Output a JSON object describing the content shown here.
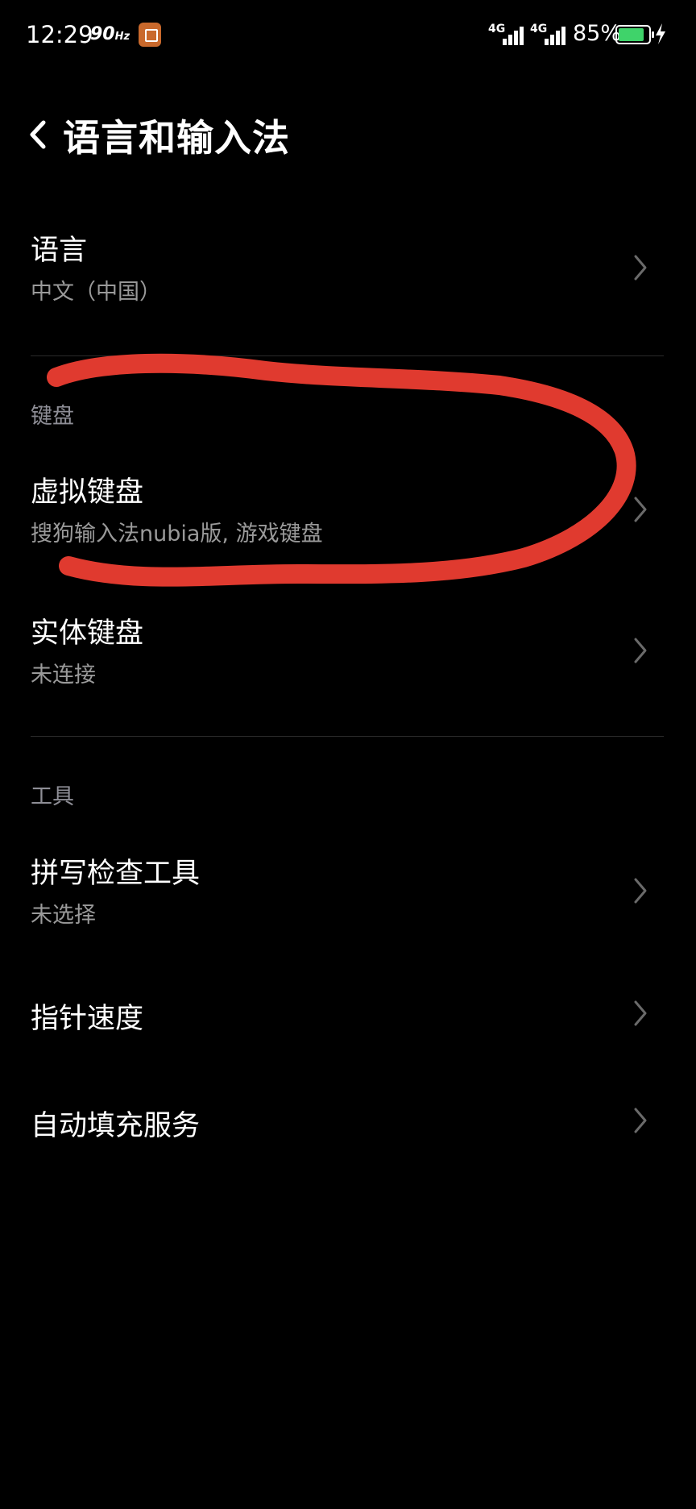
{
  "status_bar": {
    "time": "12:29",
    "refresh_rate": "90",
    "refresh_unit": "Hz",
    "sim1_network": "4G",
    "sim2_network": "4G",
    "battery_percent": "85%",
    "battery_level": 0.85,
    "charging": true,
    "battery_color": "#3fd36a"
  },
  "header": {
    "title": "语言和输入法"
  },
  "items": {
    "language": {
      "title": "语言",
      "subtitle": "中文（中国）"
    },
    "virtual_keyboard": {
      "title": "虚拟键盘",
      "subtitle": "搜狗输入法nubia版, 游戏键盘"
    },
    "physical_keyboard": {
      "title": "实体键盘",
      "subtitle": "未连接"
    },
    "spell_checker": {
      "title": "拼写检查工具",
      "subtitle": "未选择"
    },
    "pointer_speed": {
      "title": "指针速度"
    },
    "autofill": {
      "title": "自动填充服务"
    }
  },
  "sections": {
    "keyboard": "键盘",
    "tools": "工具"
  },
  "annotation": {
    "color": "#e03a2f",
    "shape": "hand-drawn loop around 虚拟键盘 item"
  }
}
